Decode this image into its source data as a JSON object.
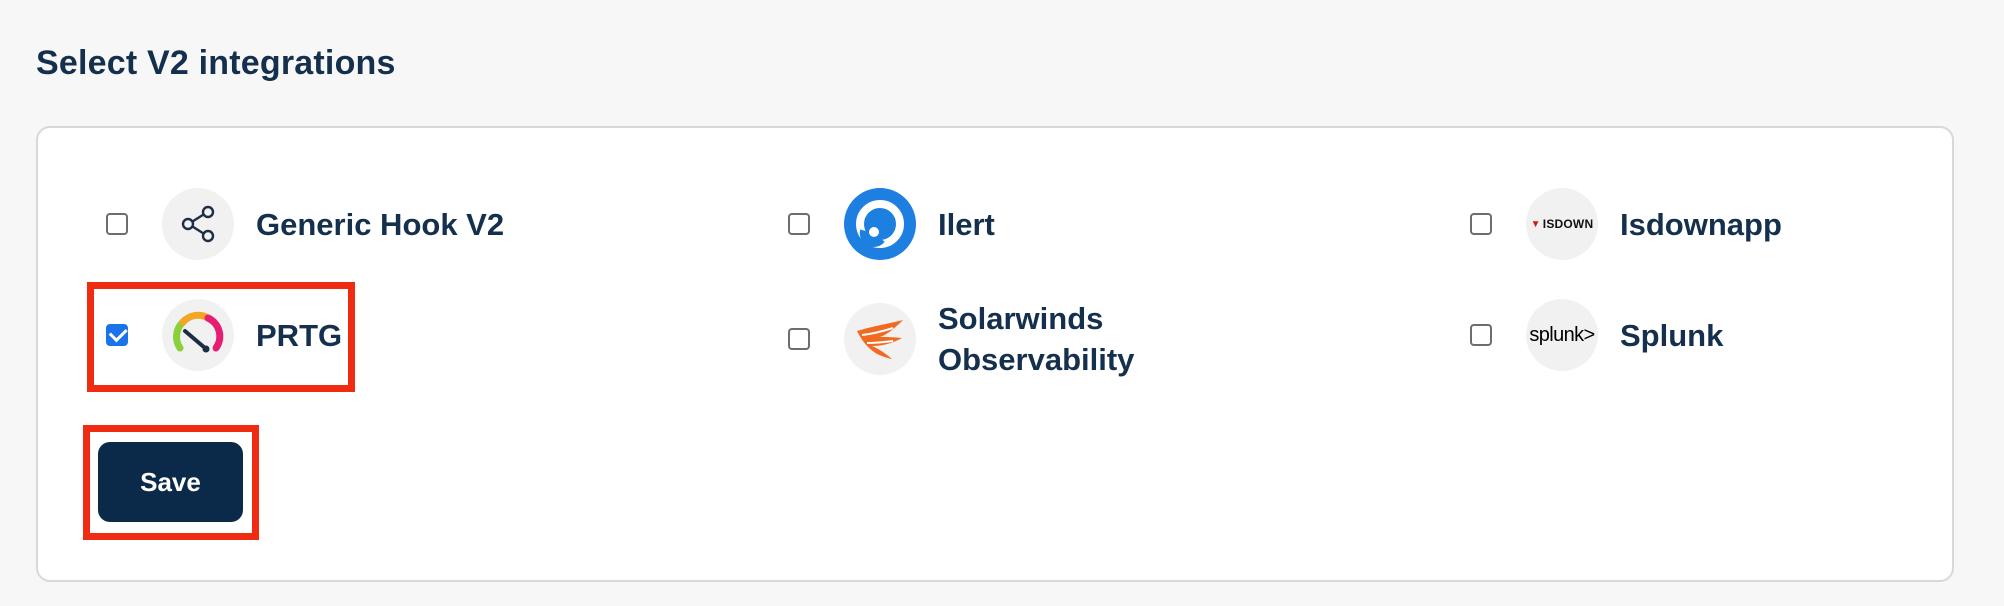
{
  "page": {
    "title": "Select V2 integrations"
  },
  "integrations": [
    {
      "label": "Generic Hook V2",
      "checked": false,
      "icon": "share-icon"
    },
    {
      "label": "Ilert",
      "checked": false,
      "icon": "ilert-logo"
    },
    {
      "label": "Isdownapp",
      "checked": false,
      "icon": "isdownapp-logo",
      "logo_text": "ISDOWN"
    },
    {
      "label": "PRTG",
      "checked": true,
      "icon": "gauge-icon"
    },
    {
      "label": "Solarwinds Observability",
      "checked": false,
      "icon": "solarwinds-logo"
    },
    {
      "label": "Splunk",
      "checked": false,
      "icon": "splunk-logo",
      "logo_text": "splunk>"
    }
  ],
  "actions": {
    "save_label": "Save"
  },
  "colors": {
    "accent": "#1a73e8",
    "primary_button": "#0b2a49",
    "highlight": "#ef2b12",
    "text": "#15304d"
  }
}
